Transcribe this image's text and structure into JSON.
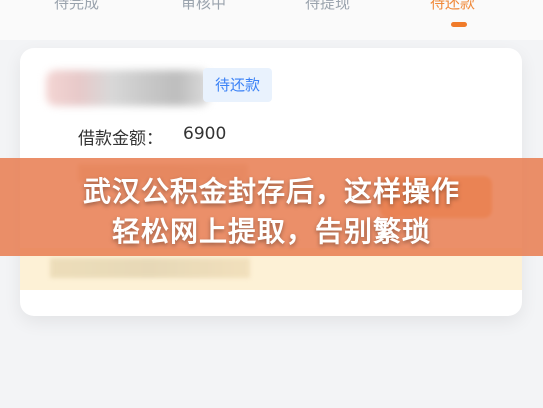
{
  "tabs": [
    {
      "label": "待完成",
      "active": false
    },
    {
      "label": "审核中",
      "active": false
    },
    {
      "label": "待提现",
      "active": false
    },
    {
      "label": "待还款",
      "active": true
    }
  ],
  "card": {
    "status_badge": "待还款",
    "amount_label": "借款金额：",
    "amount_value": "6900"
  },
  "banner": {
    "line1": "武汉公积金封存后，这样操作",
    "line2": "轻松网上提取，告别繁琐"
  },
  "colors": {
    "accent": "#f07b2a",
    "badge_text": "#3b82f6",
    "badge_bg": "#e9f2fd",
    "banner": "#e88054"
  }
}
